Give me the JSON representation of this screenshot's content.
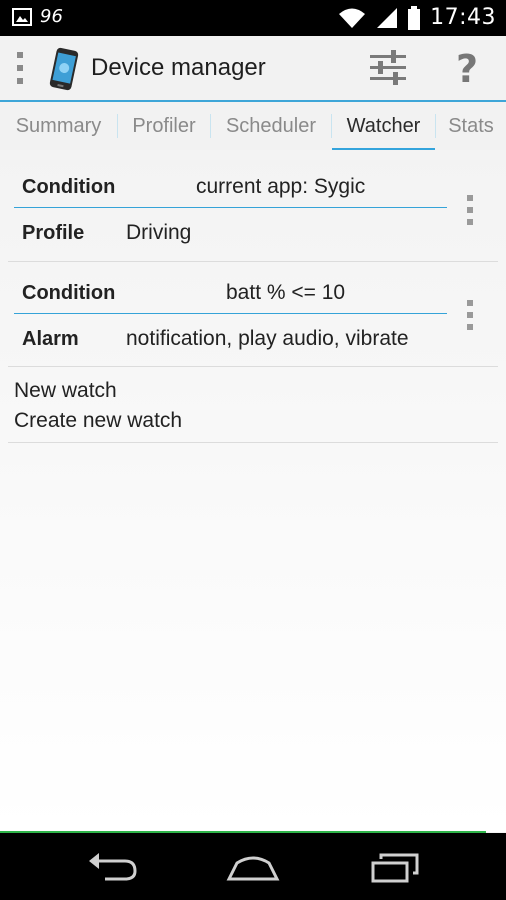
{
  "status_bar": {
    "label_96": "96",
    "time": "17:43",
    "icons": [
      "image-notification-icon",
      "wifi-icon",
      "signal-icon",
      "battery-icon"
    ]
  },
  "action_bar": {
    "title": "Device manager",
    "help_glyph": "?"
  },
  "tabs": [
    {
      "label": "Summary",
      "active": false
    },
    {
      "label": "Profiler",
      "active": false
    },
    {
      "label": "Scheduler",
      "active": false
    },
    {
      "label": "Watcher",
      "active": true
    },
    {
      "label": "Stats",
      "active": false
    }
  ],
  "watches": [
    {
      "condition_label": "Condition",
      "condition_value": "current app: Sygic",
      "action_label": "Profile",
      "action_value": "Driving"
    },
    {
      "condition_label": "Condition",
      "condition_value": "batt % <= 10",
      "action_label": "Alarm",
      "action_value": "notification, play audio, vibrate"
    }
  ],
  "new_watch": {
    "title": "New watch",
    "subtitle": "Create new watch"
  },
  "colors": {
    "accent": "#34a4dc",
    "green_line": "#2fb54a",
    "status_bar": "#000000"
  }
}
